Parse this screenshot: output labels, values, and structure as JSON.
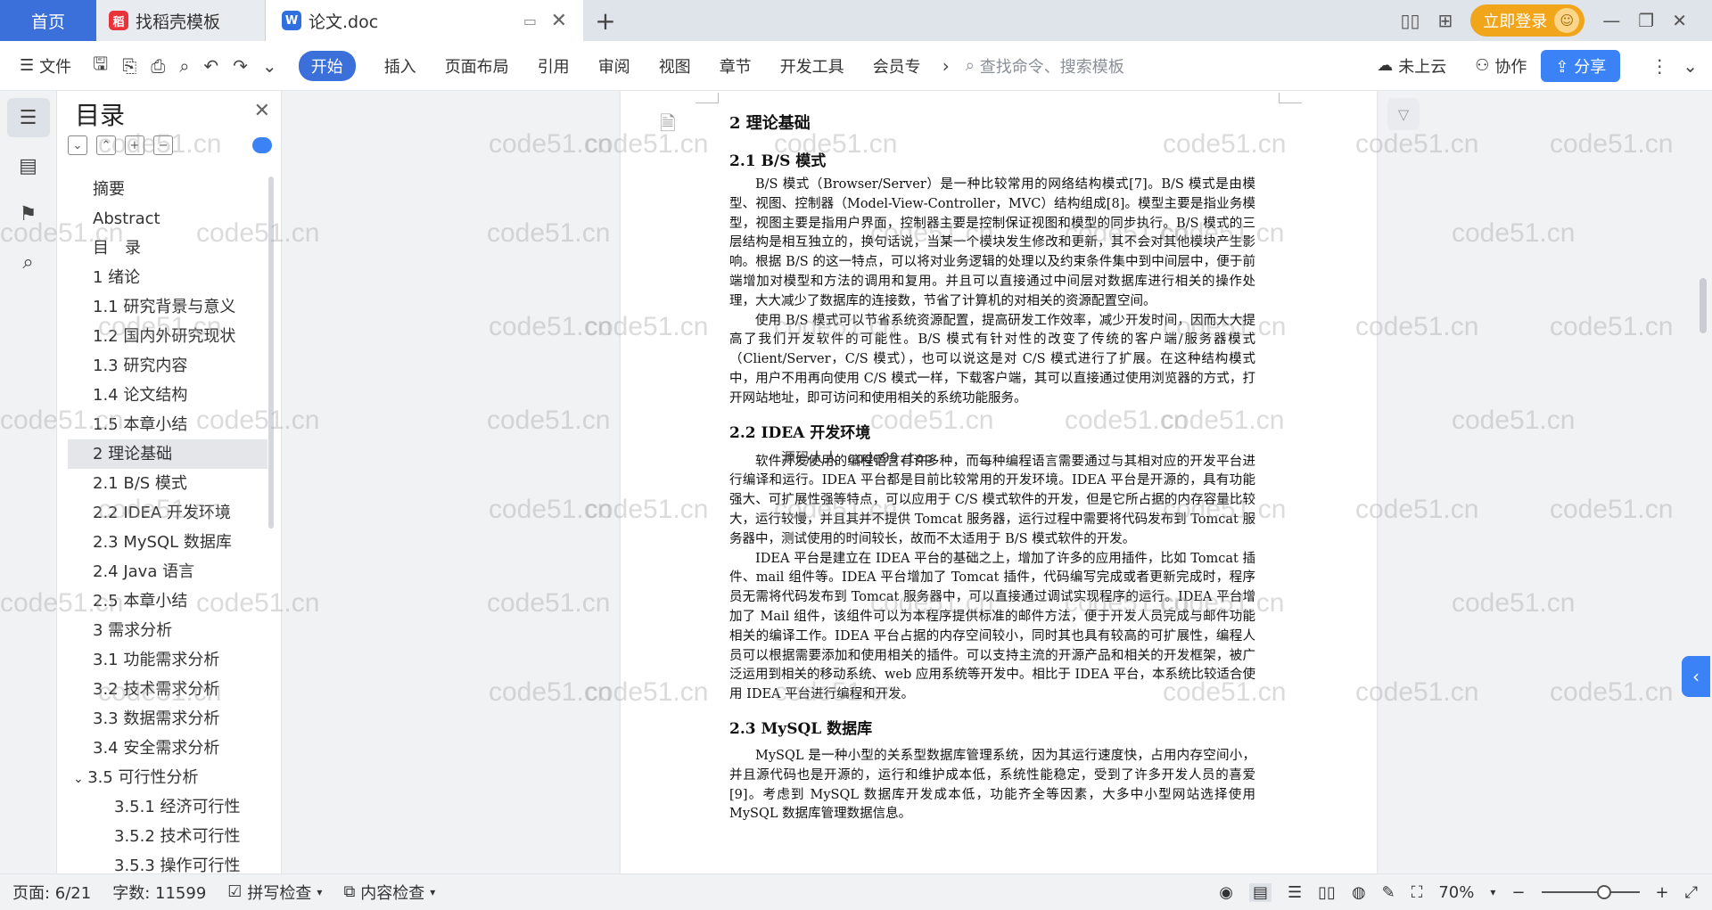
{
  "tabs": {
    "home": "首页",
    "template": "找稻壳模板",
    "document": "论文.doc"
  },
  "topbar": {
    "login": "立即登录"
  },
  "ribbon": {
    "file": "文件",
    "items": [
      "开始",
      "插入",
      "页面布局",
      "引用",
      "审阅",
      "视图",
      "章节",
      "开发工具",
      "会员专"
    ],
    "search_placeholder": "查找命令、搜索模板",
    "cloud": "未上云",
    "collab": "协作",
    "share": "分享"
  },
  "toc": {
    "title": "目录",
    "items": [
      {
        "label": "摘要",
        "level": 1
      },
      {
        "label": "Abstract",
        "level": 1
      },
      {
        "label": "目　录",
        "level": 1
      },
      {
        "label": "1 绪论",
        "level": 1
      },
      {
        "label": "1.1 研究背景与意义",
        "level": 2
      },
      {
        "label": "1.2 国内外研究现状",
        "level": 2
      },
      {
        "label": "1.3 研究内容",
        "level": 2
      },
      {
        "label": "1.4 论文结构",
        "level": 2
      },
      {
        "label": "1.5 本章小结",
        "level": 2
      },
      {
        "label": "2 理论基础",
        "level": 1,
        "selected": true
      },
      {
        "label": "2.1 B/S 模式",
        "level": 2
      },
      {
        "label": "2.2 IDEA 开发环境",
        "level": 2
      },
      {
        "label": "2.3 MySQL 数据库",
        "level": 2
      },
      {
        "label": "2.4 Java 语言",
        "level": 2
      },
      {
        "label": "2.5 本章小结",
        "level": 2
      },
      {
        "label": "3 需求分析",
        "level": 1
      },
      {
        "label": "3.1 功能需求分析",
        "level": 2
      },
      {
        "label": "3.2 技术需求分析",
        "level": 2
      },
      {
        "label": "3.3 数据需求分析",
        "level": 2
      },
      {
        "label": "3.4 安全需求分析",
        "level": 2
      },
      {
        "label": "3.5 可行性分析",
        "level": 2,
        "expanded": true
      },
      {
        "label": "3.5.1 经济可行性",
        "level": 3
      },
      {
        "label": "3.5.2 技术可行性",
        "level": 3
      },
      {
        "label": "3.5.3 操作可行性",
        "level": 3
      }
    ]
  },
  "document": {
    "h1": "2 理论基础",
    "s1_title": "2.1 B/S 模式",
    "s1_p1": "B/S 模式（Browser/Server）是一种比较常用的网络结构模式[7]。B/S 模式是由模型、视图、控制器（Model-View-Controller，MVC）结构组成[8]。模型主要是指业务模型，视图主要是指用户界面，控制器主要是控制保证视图和模型的同步执行。B/S 模式的三层结构是相互独立的，换句话说，当某一个模块发生修改和更新，其不会对其他模块产生影响。根据 B/S 的这一特点，可以将对业务逻辑的处理以及约束条件集中到中间层中，便于前端增加对模型和方法的调用和复用。并且可以直接通过中间层对数据库进行相关的操作处理，大大减少了数据库的连接数，节省了计算机的对相关的资源配置空间。",
    "s1_p2": "使用 B/S 模式可以节省系统资源配置，提高研发工作效率，减少开发时间，因而大大提高了我们开发软件的可能性。B/S 模式有针对性的改变了传统的客户端/服务器模式（Client/Server，C/S 模式），也可以说这是对 C/S 模式进行了扩展。在这种结构模式中，用户不用再向使用 C/S 模式一样，下载客户端，其可以直接通过使用浏览器的方式，打开网站地址，即可访问和使用相关的系统功能服务。",
    "s2_title": "2.2 IDEA 开发环境",
    "source_watermark": "源码人人 code99.top",
    "s2_p1": "软件开发使用的编程语言有许多种，而每种编程语言需要通过与其相对应的开发平台进行编译和运行。IDEA 平台都是目前比较常用的开发环境。IDEA 平台是开源的，具有功能强大、可扩展性强等特点，可以应用于 C/S 模式软件的开发，但是它所占据的内存容量比较大，运行较慢，并且其并不提供 Tomcat 服务器，运行过程中需要将代码发布到 Tomcat 服务器中，测试使用的时间较长，故而不太适用于 B/S 模式软件的开发。",
    "s2_p2": "IDEA 平台是建立在 IDEA 平台的基础之上，增加了许多的应用插件，比如 Tomcat 插件、mail 组件等。IDEA 平台增加了 Tomcat 插件，代码编写完成或者更新完成时，程序员无需将代码发布到 Tomcat 服务器中，可以直接通过调试实现程序的运行。IDEA 平台增加了 Mail 组件，该组件可以为本程序提供标准的邮件方法，便于开发人员完成与邮件功能相关的编译工作。IDEA 平台占据的内存空间较小，同时其也具有较高的可扩展性，编程人员可以根据需要添加和使用相关的插件。可以支持主流的开源产品和相关的开发框架，被广泛运用到相关的移动系统、web 应用系统等开发中。相比于 IDEA 平台，本系统比较适合使用 IDEA 平台进行编程和开发。",
    "s3_title": "2.3 MySQL 数据库",
    "s3_p1": "MySQL 是一种小型的关系型数据库管理系统，因为其运行速度快，占用内存空间小，并且源代码也是开源的，运行和维护成本低，系统性能稳定，受到了许多开发人员的喜爱[9]。考虑到 MySQL 数据库开发成本低，功能齐全等因素，大多中小型网站选择使用 MySQL 数据库管理数据信息。"
  },
  "watermark": "code51.cn",
  "status": {
    "page": "页面: 6/21",
    "words": "字数: 11599",
    "spell": "拼写检查",
    "content_check": "内容检查",
    "zoom": "70%"
  }
}
